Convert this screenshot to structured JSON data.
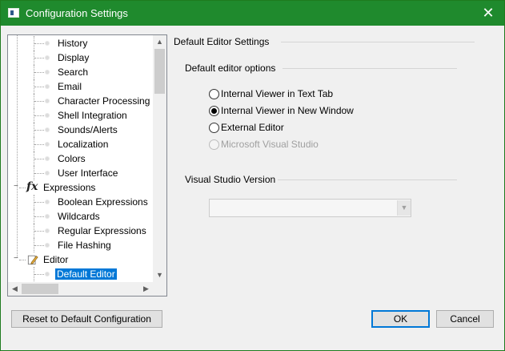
{
  "window": {
    "title": "Configuration Settings",
    "close_glyph": "✕",
    "accent_color": "#1f8a2d"
  },
  "tree": {
    "items": [
      {
        "label": "History",
        "type": "leaf"
      },
      {
        "label": "Display",
        "type": "leaf"
      },
      {
        "label": "Search",
        "type": "leaf"
      },
      {
        "label": "Email",
        "type": "leaf"
      },
      {
        "label": "Character Processing",
        "type": "leaf"
      },
      {
        "label": "Shell Integration",
        "type": "leaf"
      },
      {
        "label": "Sounds/Alerts",
        "type": "leaf"
      },
      {
        "label": "Localization",
        "type": "leaf"
      },
      {
        "label": "Colors",
        "type": "leaf"
      },
      {
        "label": "User Interface",
        "type": "leaf"
      },
      {
        "label": "Expressions",
        "type": "group",
        "icon": "fx-icon",
        "expander": "−"
      },
      {
        "label": "Boolean Expressions",
        "type": "leaf"
      },
      {
        "label": "Wildcards",
        "type": "leaf"
      },
      {
        "label": "Regular Expressions",
        "type": "leaf"
      },
      {
        "label": "File Hashing",
        "type": "leaf"
      },
      {
        "label": "Editor",
        "type": "group",
        "icon": "editor-icon",
        "expander": "−"
      },
      {
        "label": "Default Editor",
        "type": "leaf",
        "selected": true
      }
    ],
    "fx_glyph": "fx",
    "scroll_up_glyph": "▲",
    "scroll_down_glyph": "▼",
    "scroll_left_glyph": "◀",
    "scroll_right_glyph": "▶"
  },
  "panel": {
    "section_title": "Default Editor Settings",
    "options_group_title": "Default editor options",
    "radio_options": [
      {
        "label": "Internal Viewer in Text Tab",
        "checked": false,
        "disabled": false
      },
      {
        "label": "Internal Viewer in New Window",
        "checked": true,
        "disabled": false
      },
      {
        "label": "External Editor",
        "checked": false,
        "disabled": false
      },
      {
        "label": "Microsoft Visual Studio",
        "checked": false,
        "disabled": true
      }
    ],
    "vs_group_title": "Visual Studio Version",
    "vs_combo_value": "",
    "combo_arrow_glyph": "▼"
  },
  "buttons": {
    "reset": "Reset to Default Configuration",
    "ok": "OK",
    "cancel": "Cancel"
  }
}
